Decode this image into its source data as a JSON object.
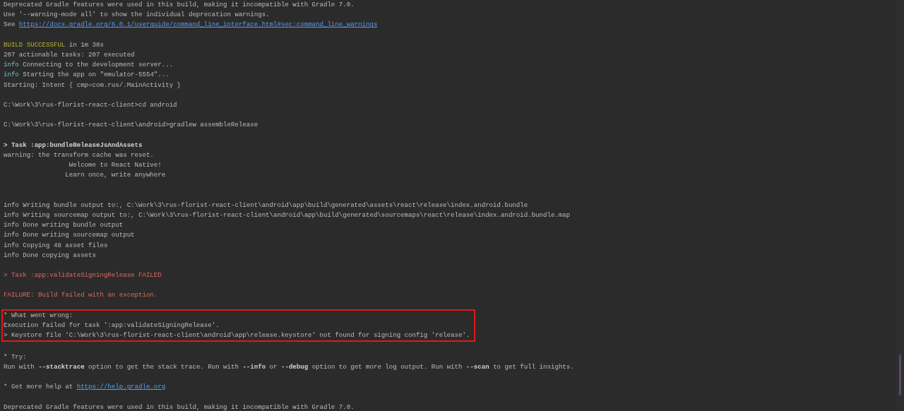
{
  "console": {
    "blocks": [
      {
        "kind": "normal",
        "highlighted": false,
        "lines": [
          {
            "segments": [
              {
                "kind": "plain",
                "text": "Deprecated Gradle features were used in this build, making it incompatible with Gradle 7.0."
              }
            ]
          },
          {
            "segments": [
              {
                "kind": "plain",
                "text": "Use '--warning-mode all' to show the individual deprecation warnings."
              }
            ]
          },
          {
            "segments": [
              {
                "kind": "plain",
                "text": "See "
              },
              {
                "kind": "link",
                "text": "https://docs.gradle.org/6.0.1/userguide/command_line_interface.html#sec:command_line_warnings"
              }
            ]
          }
        ]
      },
      {
        "kind": "normal",
        "highlighted": false,
        "lines": [
          {
            "segments": [
              {
                "kind": "success",
                "text": "BUILD SUCCESSFUL"
              },
              {
                "kind": "plain",
                "text": " in 1m 38s"
              }
            ]
          },
          {
            "segments": [
              {
                "kind": "plain",
                "text": "207 actionable tasks: 207 executed"
              }
            ]
          },
          {
            "segments": [
              {
                "kind": "info",
                "text": "info"
              },
              {
                "kind": "plain",
                "text": " Connecting to the development server..."
              }
            ]
          },
          {
            "segments": [
              {
                "kind": "info",
                "text": "info"
              },
              {
                "kind": "plain",
                "text": " Starting the app on \"emulator-5554\"..."
              }
            ]
          },
          {
            "segments": [
              {
                "kind": "plain",
                "text": "Starting: Intent { cmp=com.rus/.MainActivity }"
              }
            ]
          }
        ]
      },
      {
        "kind": "normal",
        "highlighted": false,
        "lines": [
          {
            "segments": [
              {
                "kind": "plain",
                "text": "C:\\Work\\3\\rus-florist-react-client>cd android"
              }
            ]
          }
        ]
      },
      {
        "kind": "normal",
        "highlighted": false,
        "lines": [
          {
            "segments": [
              {
                "kind": "plain",
                "text": "C:\\Work\\3\\rus-florist-react-client\\android>gradlew assembleRelease"
              }
            ]
          }
        ]
      },
      {
        "kind": "banner",
        "highlighted": false,
        "lines": [
          {
            "segments": [
              {
                "kind": "bold",
                "text": "> Task :app:bundleReleaseJsAndAssets"
              }
            ]
          },
          {
            "segments": [
              {
                "kind": "plain",
                "text": "warning: the transform cache was reset."
              }
            ]
          },
          {
            "segments": [
              {
                "kind": "plain",
                "text": "                 Welcome to React Native!"
              }
            ]
          },
          {
            "segments": [
              {
                "kind": "plain",
                "text": "                Learn once, write anywhere"
              }
            ]
          }
        ]
      },
      {
        "kind": "normal",
        "highlighted": false,
        "lines": [
          {
            "segments": [
              {
                "kind": "plain",
                "text": "info Writing bundle output to:, C:\\Work\\3\\rus-florist-react-client\\android\\app\\build\\generated\\assets\\react\\release\\index.android.bundle"
              }
            ]
          },
          {
            "segments": [
              {
                "kind": "plain",
                "text": "info Writing sourcemap output to:, C:\\Work\\3\\rus-florist-react-client\\android\\app\\build\\generated\\sourcemaps\\react\\release\\index.android.bundle.map"
              }
            ]
          },
          {
            "segments": [
              {
                "kind": "plain",
                "text": "info Done writing bundle output"
              }
            ]
          },
          {
            "segments": [
              {
                "kind": "plain",
                "text": "info Done writing sourcemap output"
              }
            ]
          },
          {
            "segments": [
              {
                "kind": "plain",
                "text": "info Copying 48 asset files"
              }
            ]
          },
          {
            "segments": [
              {
                "kind": "plain",
                "text": "info Done copying assets"
              }
            ]
          }
        ]
      },
      {
        "kind": "normal",
        "highlighted": false,
        "lines": [
          {
            "segments": [
              {
                "kind": "error",
                "text": "> Task :app:validateSigningRelease FAILED"
              }
            ]
          }
        ]
      },
      {
        "kind": "normal",
        "highlighted": false,
        "lines": [
          {
            "segments": [
              {
                "kind": "error",
                "text": "FAILURE: Build failed with an exception."
              }
            ]
          }
        ]
      },
      {
        "kind": "normal",
        "highlighted": true,
        "lines": [
          {
            "segments": [
              {
                "kind": "plain",
                "text": "* What went wrong:"
              }
            ]
          },
          {
            "segments": [
              {
                "kind": "plain",
                "text": "Execution failed for task ':app:validateSigningRelease'."
              }
            ]
          },
          {
            "segments": [
              {
                "kind": "plain",
                "text": "> Keystore file 'C:\\Work\\3\\rus-florist-react-client\\android\\app\\release.keystore' not found for signing config 'release'."
              }
            ]
          }
        ]
      },
      {
        "kind": "normal",
        "highlighted": false,
        "lines": [
          {
            "segments": [
              {
                "kind": "plain",
                "text": "* Try:"
              }
            ]
          },
          {
            "segments": [
              {
                "kind": "plain",
                "text": "Run with "
              },
              {
                "kind": "bold",
                "text": "--stacktrace"
              },
              {
                "kind": "plain",
                "text": " option to get the stack trace. Run with "
              },
              {
                "kind": "bold",
                "text": "--info"
              },
              {
                "kind": "plain",
                "text": " or "
              },
              {
                "kind": "bold",
                "text": "--debug"
              },
              {
                "kind": "plain",
                "text": " option to get more log output. Run with "
              },
              {
                "kind": "bold",
                "text": "--scan"
              },
              {
                "kind": "plain",
                "text": " to get full insights."
              }
            ]
          }
        ]
      },
      {
        "kind": "normal",
        "highlighted": false,
        "lines": [
          {
            "segments": [
              {
                "kind": "plain",
                "text": "* Get more help at "
              },
              {
                "kind": "link",
                "text": "https://help.gradle.org"
              }
            ]
          }
        ]
      },
      {
        "kind": "normal",
        "highlighted": false,
        "lines": [
          {
            "segments": [
              {
                "kind": "plain",
                "text": "Deprecated Gradle features were used in this build, making it incompatible with Gradle 7.0."
              }
            ]
          }
        ]
      }
    ]
  }
}
